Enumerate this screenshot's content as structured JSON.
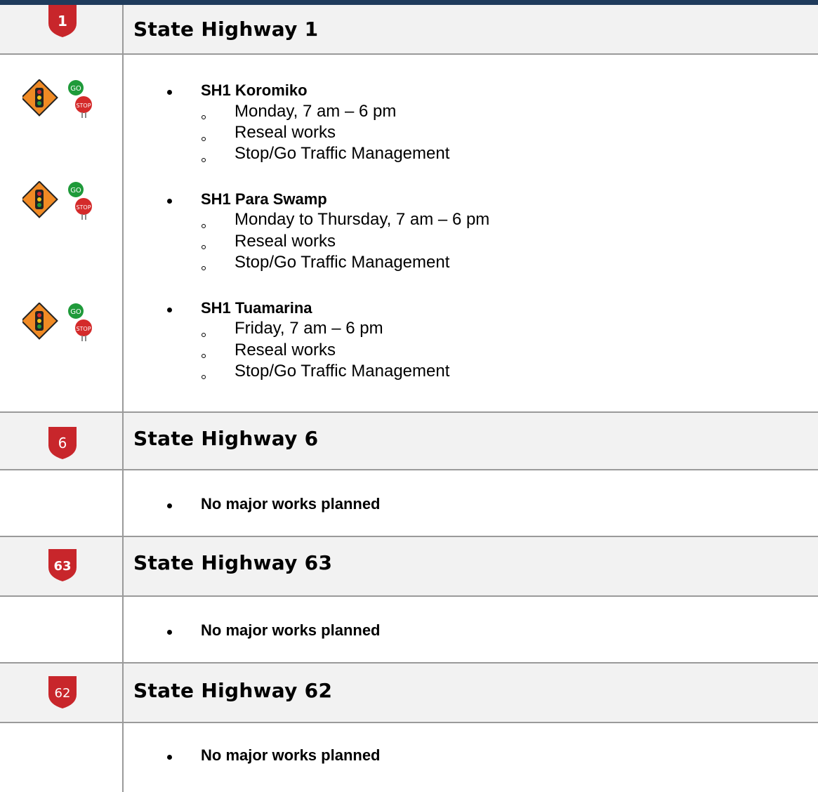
{
  "sections": [
    {
      "route": "1",
      "title": "State Highway 1",
      "works": [
        {
          "name": "SH1 Koromiko",
          "details": [
            "Monday, 7 am – 6 pm",
            "Reseal works",
            "Stop/Go Traffic Management"
          ]
        },
        {
          "name": "SH1 Para Swamp",
          "details": [
            "Monday to Thursday, 7 am – 6 pm",
            "Reseal works",
            "Stop/Go Traffic Management"
          ]
        },
        {
          "name": "SH1 Tuamarina",
          "details": [
            "Friday, 7 am – 6 pm",
            "Reseal works",
            "Stop/Go Traffic Management"
          ]
        }
      ],
      "sign_go": "GO",
      "sign_stop": "STOP"
    },
    {
      "route": "6",
      "title": "State Highway 6",
      "note": "No major works planned"
    },
    {
      "route": "63",
      "title": "State Highway 63",
      "note": "No major works planned"
    },
    {
      "route": "62",
      "title": "State Highway 62",
      "note": "No major works planned"
    }
  ],
  "colors": {
    "shield_red": "#c8262b",
    "diamond_orange": "#f08a24",
    "go_green": "#1f9a3a",
    "stop_red": "#d42a2a",
    "header_bg": "#f2f2f2",
    "top_bar": "#1f3b5c"
  }
}
